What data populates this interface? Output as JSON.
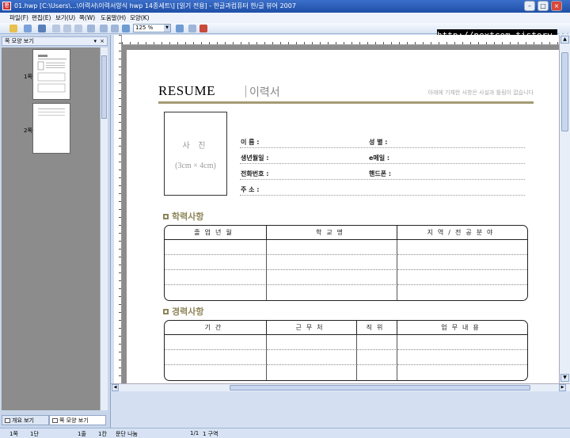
{
  "window": {
    "title": "01.hwp [C:\\Users\\...\\이력서\\이력서양식 hwp 14종세트\\] [읽기 전용] - 한글과컴퓨터 한/글 뷰어 2007",
    "app_icon": "한"
  },
  "menu": [
    "파일(F)",
    "편집(E)",
    "보기(U)",
    "쪽(W)",
    "도움말(H)",
    "모양(K)"
  ],
  "toolbar": {
    "zoom": "125 %"
  },
  "watermark": "http://nextcom.tistory.com",
  "left_panel": {
    "title": "쪽 모양 보기",
    "pages": [
      "1쪽",
      "2쪽"
    ],
    "tabs": [
      "개요 보기",
      "쪽 모양 보기"
    ]
  },
  "resume": {
    "title": "RESUME",
    "subtitle": "이력서",
    "note": "아래에 기재한 사항은 사실과 틀림이 없습니다",
    "photo": {
      "line1": "사 진",
      "line2": "(3cm × 4cm)"
    },
    "fields": {
      "name": "이    름 :",
      "gender": "성    별 :",
      "birth": "생년월일 :",
      "email": "e메일 :",
      "phone": "전화번호 :",
      "mobile": "핸드폰 :",
      "address": "주    소 :"
    },
    "education": {
      "title": "학력사항",
      "headers": [
        "졸업년월",
        "학교명",
        "지역/전공분야"
      ]
    },
    "career": {
      "title": "경력사항",
      "headers": [
        "기간",
        "근무처",
        "직위",
        "업무내용"
      ]
    }
  },
  "status": {
    "page": "1쪽",
    "section": "1단",
    "line": "1줄",
    "col": "1칸",
    "mode": "문단 나눔",
    "pos": "1/1",
    "area": "1 구역"
  }
}
